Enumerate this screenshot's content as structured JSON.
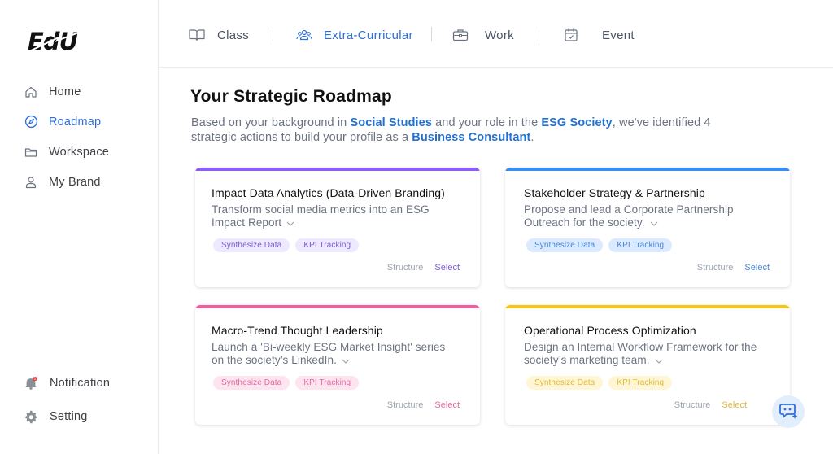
{
  "app": {
    "logo_text": "EdU"
  },
  "sidebar": {
    "items": [
      {
        "label": "Home",
        "icon": "home-icon"
      },
      {
        "label": "Roadmap",
        "icon": "compass-icon",
        "active": true
      },
      {
        "label": "Workspace",
        "icon": "folder-icon"
      },
      {
        "label": "My Brand",
        "icon": "user-icon"
      }
    ],
    "bottom_items": [
      {
        "label": "Notification",
        "icon": "bell-icon",
        "badge": "1"
      },
      {
        "label": "Setting",
        "icon": "gear-icon"
      }
    ]
  },
  "tabs": [
    {
      "label": "Class",
      "icon": "book-icon"
    },
    {
      "label": "Extra-Curricular",
      "icon": "users-icon",
      "active": true
    },
    {
      "label": "Work",
      "icon": "briefcase-icon"
    },
    {
      "label": "Event",
      "icon": "calendar-icon"
    }
  ],
  "main": {
    "title": "Your Strategic Roadmap",
    "intro": {
      "p1": "Based on your background in ",
      "background": "Social Studies",
      "p2": " and your role in the ",
      "role_org": "ESG Society",
      "p3": ", we've identified 4 strategic actions to build your profile as a ",
      "target_role": "Business Consultant",
      "p4": "."
    },
    "cards": [
      {
        "title": "Impact Data Analytics (Data-Driven Branding)",
        "description": "Transform social media metrics into an ESG Impact Report",
        "chips": [
          "Synthesize Data",
          "KPI Tracking"
        ],
        "structure_label": "Structure",
        "select_label": "Select",
        "accent": "#8b5cf6",
        "chip_bg": "#ede9fe",
        "chip_fg": "#7c5ccf"
      },
      {
        "title": "Stakeholder Strategy & Partnership",
        "description": "Propose and lead a Corporate Partnership Outreach for the society.",
        "chips": [
          "Synthesize Data",
          "KPI Tracking"
        ],
        "structure_label": "Structure",
        "select_label": "Select",
        "accent": "#3b8cf0",
        "chip_bg": "#dbeafe",
        "chip_fg": "#4a86d6"
      },
      {
        "title": "Macro-Trend Thought Leadership",
        "description": "Launch a 'Bi-weekly ESG Market Insight' series on the society’s LinkedIn.",
        "chips": [
          "Synthesize Data",
          "KPI Tracking"
        ],
        "structure_label": "Structure",
        "select_label": "Select",
        "accent": "#ec5f9c",
        "chip_bg": "#fde4ef",
        "chip_fg": "#e46aa1"
      },
      {
        "title": "Operational Process Optimization",
        "description": "Design an Internal Workflow Framework for the society’s marketing team.",
        "chips": [
          "Synthesize Data",
          "KPI Tracking"
        ],
        "structure_label": "Structure",
        "select_label": "Select",
        "accent": "#f5c518",
        "chip_bg": "#fef6d4",
        "chip_fg": "#e0b83a"
      }
    ]
  },
  "colors": {
    "primary": "#2f6fd6",
    "highlight": "#2170d4"
  }
}
